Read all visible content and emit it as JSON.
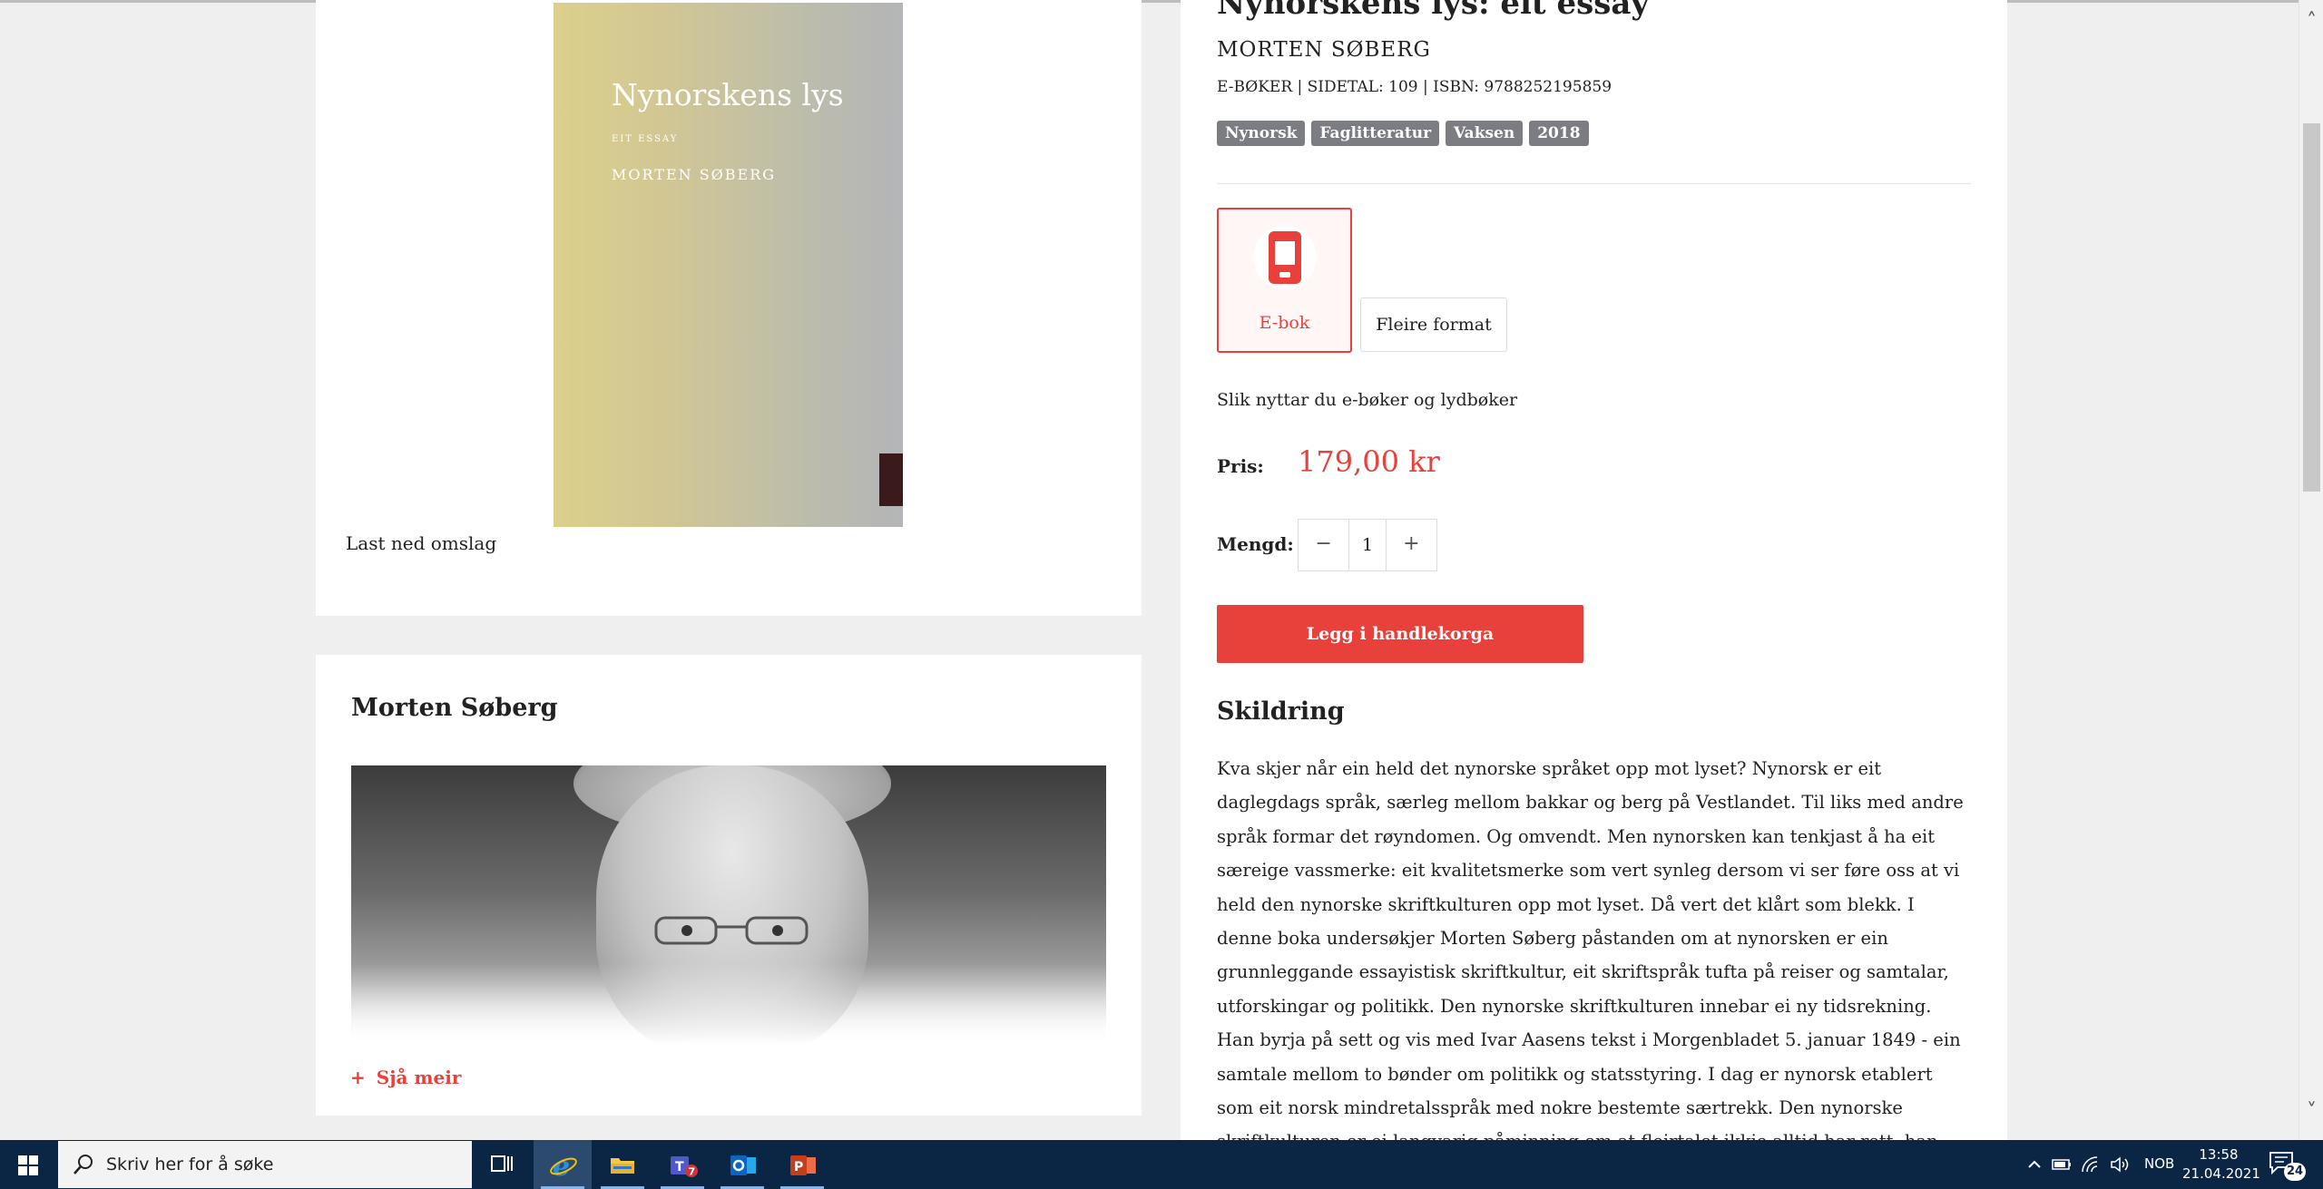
{
  "cover": {
    "title": "Nynorskens lys",
    "subtitle": "EIT ESSAY",
    "author": "MORTEN SØBERG",
    "download_label": "Last ned omslag"
  },
  "author_card": {
    "name": "Morten Søberg",
    "see_more_icon": "+",
    "see_more_label": "Sjå meir"
  },
  "product": {
    "title": "Nynorskens lys: eit essay",
    "author": "MORTEN SØBERG",
    "meta": "E-BØKER | SIDETAL: 109 | ISBN: 9788252195859",
    "tags": [
      "Nynorsk",
      "Faglitteratur",
      "Vaksen",
      "2018"
    ],
    "formats": {
      "ebook_label": "E-bok",
      "more_label": "Fleire format"
    },
    "howto_link": "Slik nyttar du e-bøker og lydbøker",
    "price_label": "Pris:",
    "price": "179,00 kr",
    "quantity_label": "Mengd:",
    "quantity": "1",
    "minus": "−",
    "plus": "+",
    "cart_button": "Legg i handlekorga",
    "description_heading": "Skildring",
    "description": "Kva skjer når ein held det nynorske språket opp mot lyset? Nynorsk er eit daglegdags språk, særleg mellom bakkar og berg på Vestlandet. Til liks med andre språk formar det røyndomen. Og omvendt. Men nynorsken kan tenkjast å ha eit særeige vassmerke: eit kvalitetsmerke som vert synleg dersom vi ser føre oss at vi held den nynorske skriftkulturen opp mot lyset. Då vert det klårt som blekk. I denne boka undersøkjer Morten Søberg påstanden om at nynorsken er ein grunnleggande essayistisk skriftkultur, eit skriftspråk tufta på reiser og samtalar, utforskingar og politikk. Den nynorske skriftkulturen innebar ei ny tidsrekning. Han byrja på sett og vis med Ivar Aasens tekst i Morgenbladet 5. januar 1849 - ein samtale mellom to bønder om politikk og statsstyring. I dag er nynorsk etablert som eit norsk mindretalsspråk med nokre bestemte særtrekk. Den nynorske skriftkulturen er ei langvarig påminning om at fleirtalet ikkje alltid har rett, han viser at det finst alternative språklege fakta, røynsler og"
  },
  "colors": {
    "accent": "#e8403a",
    "tag": "#7b7d82",
    "taskbar": "#0b2644"
  },
  "taskbar": {
    "search_placeholder": "Skriv her for å søke",
    "teams_badge": "7",
    "language": "NOB",
    "time": "13:58",
    "date": "21.04.2021",
    "notifications": "24",
    "icons": [
      "windows-icon",
      "search-icon",
      "task-view-icon",
      "internet-explorer-icon",
      "file-explorer-icon",
      "teams-icon",
      "outlook-icon",
      "powerpoint-icon"
    ]
  }
}
